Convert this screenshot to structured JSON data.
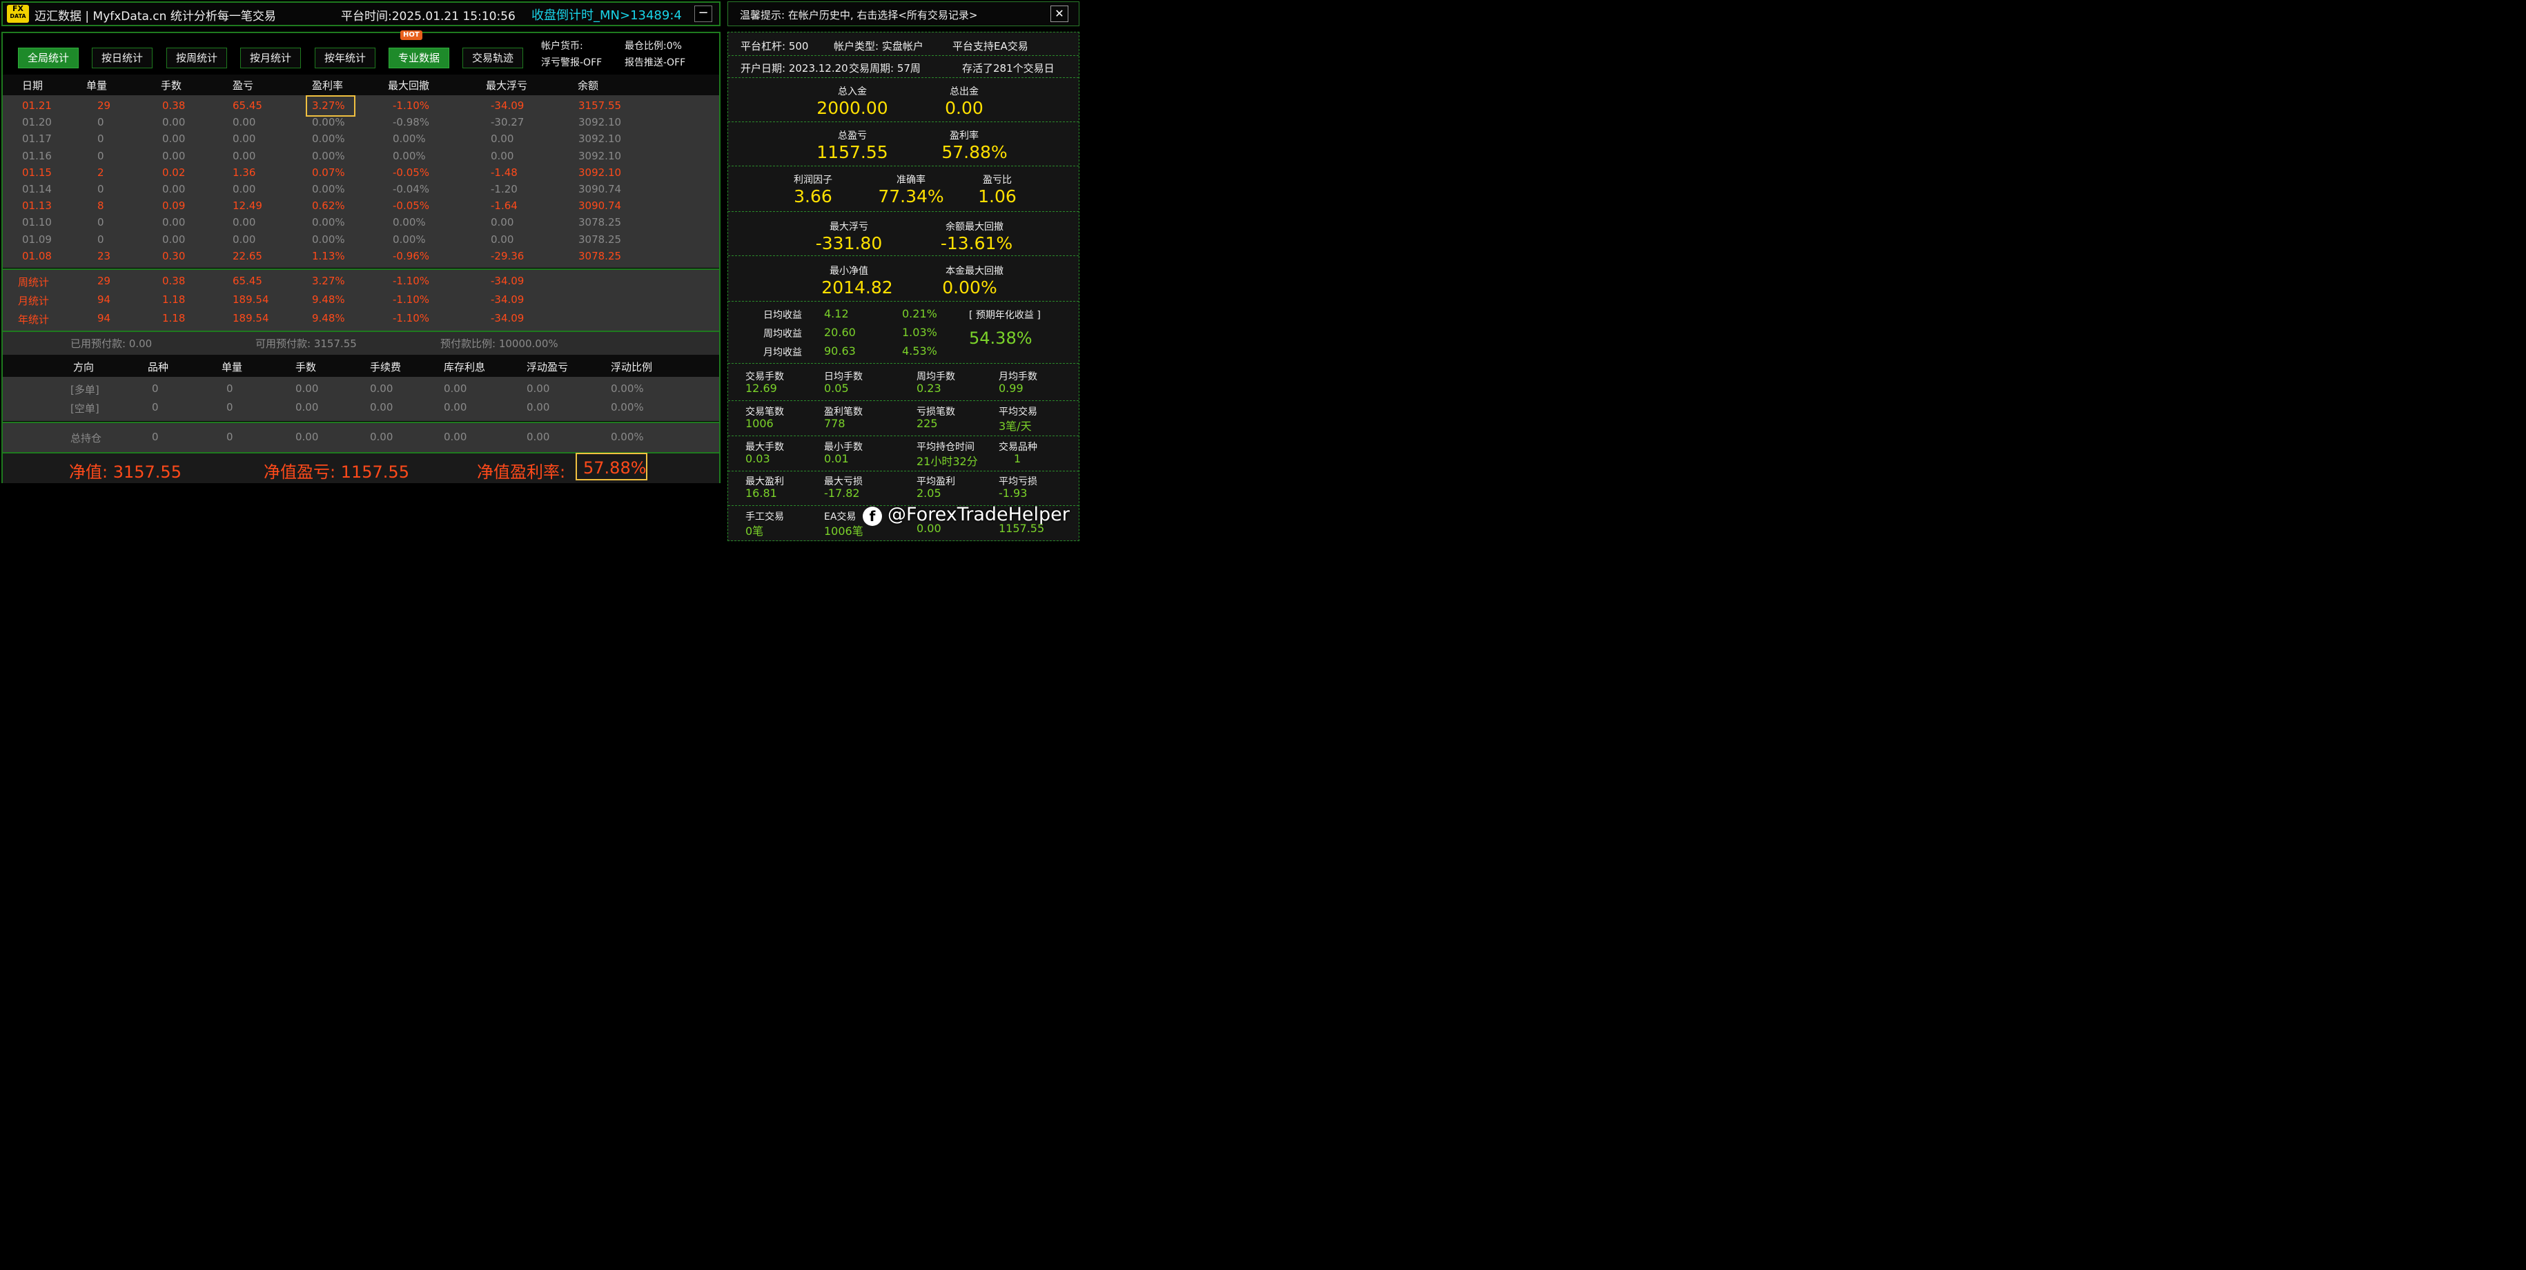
{
  "header": {
    "logo_top": "FX",
    "logo_bottom": "DATA",
    "title": "迈汇数据 | MyfxData.cn  统计分析每一笔交易",
    "platform_time": "平台时间:2025.01.21 15:10:56",
    "countdown": "收盘倒计时_MN>13489:4",
    "minimize": "−"
  },
  "tabs": [
    {
      "label": "全局统计",
      "active": true
    },
    {
      "label": "按日统计",
      "active": false
    },
    {
      "label": "按周统计",
      "active": false
    },
    {
      "label": "按月统计",
      "active": false
    },
    {
      "label": "按年统计",
      "active": false
    },
    {
      "label": "专业数据",
      "active": true
    },
    {
      "label": "交易轨迹",
      "active": false
    }
  ],
  "hot_badge": "HOT",
  "account_info": {
    "currency": "帐户货币:",
    "max_pos": "最仓比例:0%",
    "float_alert": "浮亏警报-OFF",
    "report_push": "报告推送-OFF"
  },
  "daily_table": {
    "headers": [
      "日期",
      "单量",
      "手数",
      "盈亏",
      "盈利率",
      "最大回撤",
      "最大浮亏",
      "余额"
    ],
    "rows": [
      {
        "date": "01.21",
        "orders": "29",
        "lots": "0.38",
        "pnl": "65.45",
        "rate": "3.27%",
        "drawdown": "-1.10%",
        "float_loss": "-34.09",
        "balance": "3157.55",
        "active": true
      },
      {
        "date": "01.20",
        "orders": "0",
        "lots": "0.00",
        "pnl": "0.00",
        "rate": "0.00%",
        "drawdown": "-0.98%",
        "float_loss": "-30.27",
        "balance": "3092.10",
        "active": false
      },
      {
        "date": "01.17",
        "orders": "0",
        "lots": "0.00",
        "pnl": "0.00",
        "rate": "0.00%",
        "drawdown": "0.00%",
        "float_loss": "0.00",
        "balance": "3092.10",
        "active": false
      },
      {
        "date": "01.16",
        "orders": "0",
        "lots": "0.00",
        "pnl": "0.00",
        "rate": "0.00%",
        "drawdown": "0.00%",
        "float_loss": "0.00",
        "balance": "3092.10",
        "active": false
      },
      {
        "date": "01.15",
        "orders": "2",
        "lots": "0.02",
        "pnl": "1.36",
        "rate": "0.07%",
        "drawdown": "-0.05%",
        "float_loss": "-1.48",
        "balance": "3092.10",
        "active": true
      },
      {
        "date": "01.14",
        "orders": "0",
        "lots": "0.00",
        "pnl": "0.00",
        "rate": "0.00%",
        "drawdown": "-0.04%",
        "float_loss": "-1.20",
        "balance": "3090.74",
        "active": false
      },
      {
        "date": "01.13",
        "orders": "8",
        "lots": "0.09",
        "pnl": "12.49",
        "rate": "0.62%",
        "drawdown": "-0.05%",
        "float_loss": "-1.64",
        "balance": "3090.74",
        "active": true
      },
      {
        "date": "01.10",
        "orders": "0",
        "lots": "0.00",
        "pnl": "0.00",
        "rate": "0.00%",
        "drawdown": "0.00%",
        "float_loss": "0.00",
        "balance": "3078.25",
        "active": false
      },
      {
        "date": "01.09",
        "orders": "0",
        "lots": "0.00",
        "pnl": "0.00",
        "rate": "0.00%",
        "drawdown": "0.00%",
        "float_loss": "0.00",
        "balance": "3078.25",
        "active": false
      },
      {
        "date": "01.08",
        "orders": "23",
        "lots": "0.30",
        "pnl": "22.65",
        "rate": "1.13%",
        "drawdown": "-0.96%",
        "float_loss": "-29.36",
        "balance": "3078.25",
        "active": true
      }
    ]
  },
  "summary_rows": [
    {
      "label": "周统计",
      "orders": "29",
      "lots": "0.38",
      "pnl": "65.45",
      "rate": "3.27%",
      "drawdown": "-1.10%",
      "float_loss": "-34.09"
    },
    {
      "label": "月统计",
      "orders": "94",
      "lots": "1.18",
      "pnl": "189.54",
      "rate": "9.48%",
      "drawdown": "-1.10%",
      "float_loss": "-34.09"
    },
    {
      "label": "年统计",
      "orders": "94",
      "lots": "1.18",
      "pnl": "189.54",
      "rate": "9.48%",
      "drawdown": "-1.10%",
      "float_loss": "-34.09"
    }
  ],
  "prepay": {
    "used": "已用预付款: 0.00",
    "available": "可用预付款: 3157.55",
    "ratio": "预付款比例: 10000.00%"
  },
  "position_table": {
    "headers": [
      "方向",
      "品种",
      "单量",
      "手数",
      "手续费",
      "库存利息",
      "浮动盈亏",
      "浮动比例"
    ],
    "rows": [
      {
        "dir": "[多单]",
        "symbol": "0",
        "orders": "0",
        "lots": "0.00",
        "fee": "0.00",
        "swap": "0.00",
        "float_pnl": "0.00",
        "float_ratio": "0.00%"
      },
      {
        "dir": "[空单]",
        "symbol": "0",
        "orders": "0",
        "lots": "0.00",
        "fee": "0.00",
        "swap": "0.00",
        "float_pnl": "0.00",
        "float_ratio": "0.00%"
      }
    ],
    "total": {
      "dir": "总持仓",
      "symbol": "0",
      "orders": "0",
      "lots": "0.00",
      "fee": "0.00",
      "swap": "0.00",
      "float_pnl": "0.00",
      "float_ratio": "0.00%"
    }
  },
  "net": {
    "equity": "净值: 3157.55",
    "equity_pnl": "净值盈亏: 1157.55",
    "equity_rate_label": "净值盈利率:",
    "equity_rate": "57.88%"
  },
  "right": {
    "tip": "温馨提示: 在帐户历史中, 右击选择<所有交易记录>",
    "close": "✕",
    "leverage": "平台杠杆: 500",
    "account_type": "帐户类型: 实盘帐户",
    "ea_support": "平台支持EA交易",
    "open_date": "开户日期: 2023.12.20",
    "trade_period": "交易周期: 57周",
    "stored_days": "存活了281个交易日",
    "total_deposit_label": "总入金",
    "total_deposit": "2000.00",
    "total_withdraw_label": "总出金",
    "total_withdraw": "0.00",
    "total_pnl_label": "总盈亏",
    "total_pnl": "1157.55",
    "profit_rate_label": "盈利率",
    "profit_rate": "57.88%",
    "profit_factor_label": "利润因子",
    "profit_factor": "3.66",
    "accuracy_label": "准确率",
    "accuracy": "77.34%",
    "pl_ratio_label": "盈亏比",
    "pl_ratio": "1.06",
    "max_float_label": "最大浮亏",
    "max_float": "-331.80",
    "bal_dd_label": "余额最大回撤",
    "bal_dd": "-13.61%",
    "min_equity_label": "最小净值",
    "min_equity": "2014.82",
    "principal_dd_label": "本金最大回撤",
    "principal_dd": "0.00%",
    "daily_label": "日均收益",
    "daily_val": "4.12",
    "daily_pct": "0.21%",
    "weekly_label": "周均收益",
    "weekly_val": "20.60",
    "weekly_pct": "1.03%",
    "monthly_label": "月均收益",
    "monthly_val": "90.63",
    "monthly_pct": "4.53%",
    "annual_label": "[ 预期年化收益 ]",
    "annual": "54.38%",
    "grid": [
      [
        {
          "label": "交易手数",
          "value": "12.69"
        },
        {
          "label": "日均手数",
          "value": "0.05"
        },
        {
          "label": "周均手数",
          "value": "0.23"
        },
        {
          "label": "月均手数",
          "value": "0.99"
        }
      ],
      [
        {
          "label": "交易笔数",
          "value": "1006"
        },
        {
          "label": "盈利笔数",
          "value": "778"
        },
        {
          "label": "亏损笔数",
          "value": "225"
        },
        {
          "label": "平均交易",
          "value": "3笔/天"
        }
      ],
      [
        {
          "label": "最大手数",
          "value": "0.03"
        },
        {
          "label": "最小手数",
          "value": "0.01"
        },
        {
          "label": "平均持仓时间",
          "value": "21小时32分"
        },
        {
          "label": "交易品种",
          "value": "1"
        }
      ],
      [
        {
          "label": "最大盈利",
          "value": "16.81"
        },
        {
          "label": "最大亏损",
          "value": "-17.82"
        },
        {
          "label": "平均盈利",
          "value": "2.05"
        },
        {
          "label": "平均亏损",
          "value": "-1.93"
        }
      ],
      [
        {
          "label": "手工交易",
          "value": "0笔"
        },
        {
          "label": "EA交易",
          "value": "1006笔"
        },
        {
          "label": "",
          "value": "0.00"
        },
        {
          "label": "",
          "value": "1157.55"
        }
      ]
    ],
    "watermark": "@ForexTradeHelper",
    "watermark_icon": "facebook-icon"
  },
  "colors": {
    "green_border": "#1e7a1e",
    "red": "#ff4a1a",
    "yellow": "#ffe000",
    "green_text": "#7bd32a",
    "cyan": "#19d4e8",
    "highlight": "#f0c040"
  }
}
